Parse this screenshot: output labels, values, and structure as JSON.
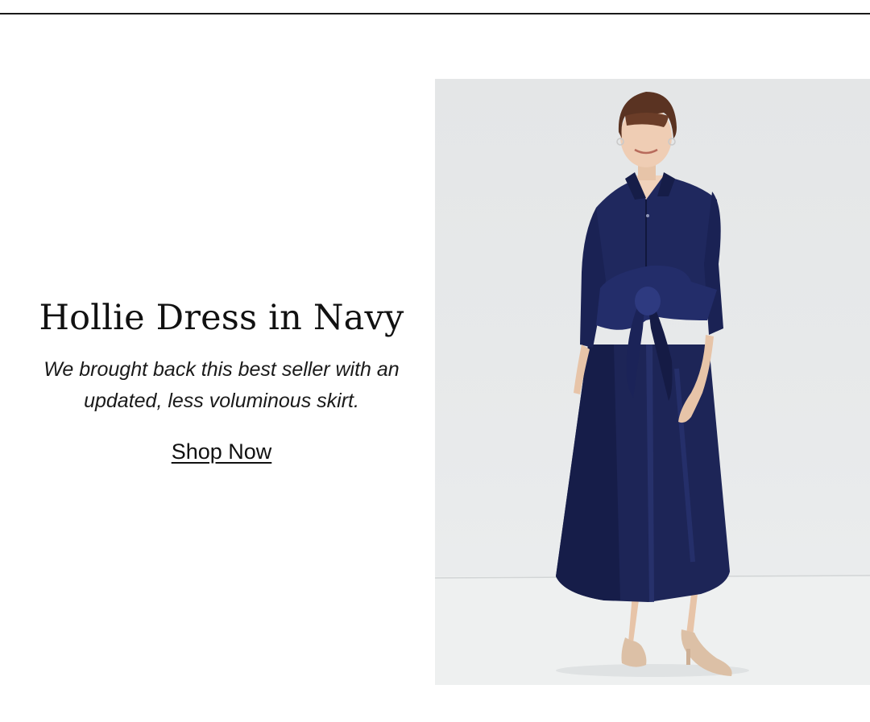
{
  "promo": {
    "title": "Hollie Dress in Navy",
    "subtitle": "We brought back this best seller with an updated, less voluminous skirt.",
    "cta_label": "Shop Now"
  },
  "product_image": {
    "subject": "model wearing navy taffeta shirt dress with large waist bow",
    "dress_color": "#1d2557",
    "background_color": "#e6e8e9"
  },
  "colors": {
    "text": "#111111",
    "rule": "#1a1a1a",
    "page_background": "#ffffff"
  }
}
